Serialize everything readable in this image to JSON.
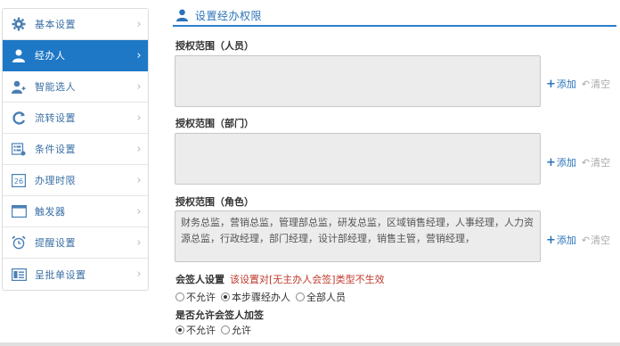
{
  "sidebar": {
    "items": [
      {
        "label": "基本设置",
        "icon": "gear-icon"
      },
      {
        "label": "经办人",
        "icon": "user-icon",
        "active": true
      },
      {
        "label": "智能选人",
        "icon": "user-add-icon"
      },
      {
        "label": "流转设置",
        "icon": "refresh-icon"
      },
      {
        "label": "条件设置",
        "icon": "condition-icon"
      },
      {
        "label": "办理时限",
        "icon": "calendar-icon"
      },
      {
        "label": "触发器",
        "icon": "window-icon"
      },
      {
        "label": "提醒设置",
        "icon": "alarm-icon"
      },
      {
        "label": "呈批单设置",
        "icon": "form-icon"
      }
    ],
    "chevron": "›",
    "accent_color": "#1e78c6"
  },
  "header": {
    "title": "设置经办权限",
    "icon": "user-icon"
  },
  "sections": {
    "people": {
      "label": "授权范围（人员）",
      "value": ""
    },
    "departments": {
      "label": "授权范围（部门）",
      "value": ""
    },
    "roles": {
      "label": "授权范围（角色）",
      "value": "财务总监，营销总监，管理部总监，研发总监，区域销售经理，人事经理，人力资源总监，行政经理，部门经理，设计部经理，销售主管，营销经理，"
    }
  },
  "actions": {
    "add_label": "添加",
    "clear_label": "清空"
  },
  "countersign": {
    "label": "会签人设置",
    "note": "该设置对[无主办人会签]类型不生效",
    "options": [
      {
        "label": "不允许",
        "checked": false
      },
      {
        "label": "本步骤经办人",
        "checked": true
      },
      {
        "label": "全部人员",
        "checked": false
      }
    ]
  },
  "allow_add_sign": {
    "label": "是否允许会签人加签",
    "options": [
      {
        "label": "不允许",
        "checked": true
      },
      {
        "label": "允许",
        "checked": false
      }
    ]
  }
}
